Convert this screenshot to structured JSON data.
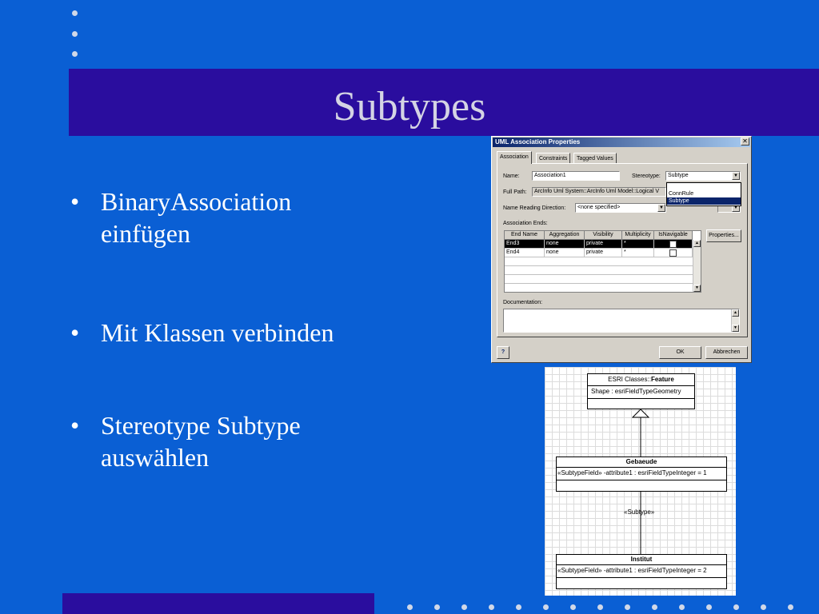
{
  "slide": {
    "title": "Subtypes",
    "bullets": [
      "BinaryAssociation einfügen",
      "Mit Klassen verbinden",
      "Stereotype Subtype auswählen"
    ]
  },
  "dialog": {
    "title": "UML Association Properties",
    "close_glyph": "✕",
    "tabs": [
      "Association",
      "Constraints",
      "Tagged Values"
    ],
    "name_label": "Name:",
    "name_value": "Association1",
    "stereotype_label": "Stereotype:",
    "stereotype_value": "Subtype",
    "stereotype_options": [
      "",
      "ConnRule",
      "Subtype"
    ],
    "fullpath_label": "Full Path:",
    "fullpath_value": "ArcInfo Uml System::ArcInfo Uml Model::Logical V",
    "reading_label": "Name Reading Direction:",
    "reading_value": "<none specified>",
    "ends_label": "Association Ends:",
    "ends_columns": [
      "End Name",
      "Aggregation",
      "Visibility",
      "Multiplicity",
      "IsNavigable"
    ],
    "ends_rows": [
      {
        "name": "End3",
        "aggregation": "none",
        "visibility": "private",
        "multiplicity": "*"
      },
      {
        "name": "End4",
        "aggregation": "none",
        "visibility": "private",
        "multiplicity": "*"
      }
    ],
    "properties_button": "Properties...",
    "documentation_label": "Documentation:",
    "help_glyph": "?",
    "ok_button": "OK",
    "cancel_button": "Abbrechen"
  },
  "uml": {
    "feature": {
      "title_prefix": "ESRI Classes::",
      "title_bold": "Feature",
      "attribute": "Shape : esriFieldTypeGeometry"
    },
    "gebaeude": {
      "title": "Gebaeude",
      "attribute": "«SubtypeField» -attribute1 : esriFieldTypeInteger = 1"
    },
    "association_stereotype": "«Subtype»",
    "institut": {
      "title": "Institut",
      "attribute": "«SubtypeField» -attribute1 : esriFieldTypeInteger = 2"
    }
  },
  "colors": {
    "background": "#0a5fd4",
    "band": "#2a0d9e",
    "title_text": "#d4d4e4",
    "selection": "#0a246a"
  }
}
